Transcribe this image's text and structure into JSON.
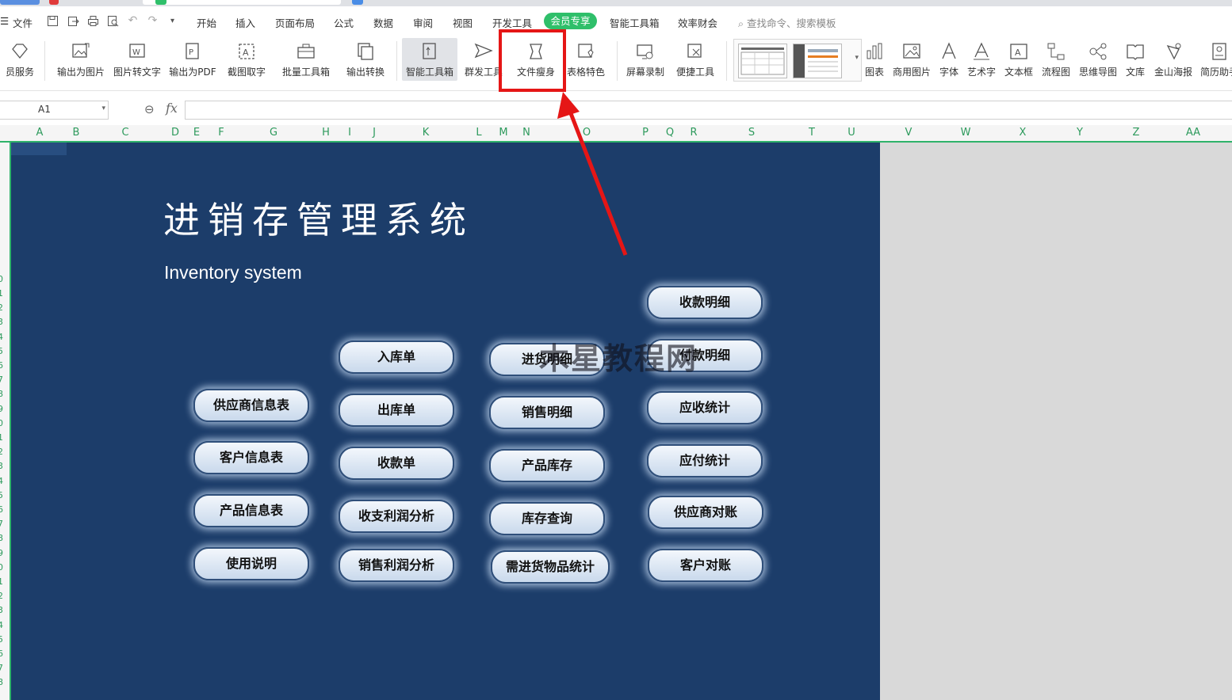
{
  "menubar": {
    "file_menu": "文件",
    "tabs": [
      "开始",
      "插入",
      "页面布局",
      "公式",
      "数据",
      "审阅",
      "视图",
      "开发工具"
    ],
    "member_tab": "会员专享",
    "extra_tabs": [
      "智能工具箱",
      "效率财会"
    ],
    "search_placeholder": "查找命令、搜索模板"
  },
  "ribbon": {
    "buttons": [
      {
        "label": "员服务",
        "icon": "diamond-icon"
      },
      {
        "label": "输出为图片",
        "icon": "export-image-icon"
      },
      {
        "label": "图片转文字",
        "icon": "image-to-text-icon"
      },
      {
        "label": "输出为PDF",
        "icon": "export-pdf-icon"
      },
      {
        "label": "截图取字",
        "icon": "screenshot-ocr-icon"
      },
      {
        "label": "批量工具箱",
        "icon": "toolbox-icon"
      },
      {
        "label": "输出转换",
        "icon": "convert-icon"
      },
      {
        "label": "智能工具箱",
        "icon": "smart-toolbox-icon"
      },
      {
        "label": "群发工具",
        "icon": "send-icon"
      },
      {
        "label": "文件瘦身",
        "icon": "file-slim-icon"
      },
      {
        "label": "表格特色",
        "icon": "table-feature-icon"
      },
      {
        "label": "屏幕录制",
        "icon": "screen-record-icon"
      },
      {
        "label": "便捷工具",
        "icon": "handy-tools-icon"
      },
      {
        "label": "图表",
        "icon": "chart-icon"
      },
      {
        "label": "商用图片",
        "icon": "picture-icon"
      },
      {
        "label": "字体",
        "icon": "font-icon"
      },
      {
        "label": "艺术字",
        "icon": "wordart-icon"
      },
      {
        "label": "文本框",
        "icon": "textbox-icon"
      },
      {
        "label": "流程图",
        "icon": "flowchart-icon"
      },
      {
        "label": "思维导图",
        "icon": "mindmap-icon"
      },
      {
        "label": "文库",
        "icon": "library-icon"
      },
      {
        "label": "金山海报",
        "icon": "poster-icon"
      },
      {
        "label": "简历助手",
        "icon": "resume-icon"
      }
    ]
  },
  "formula_bar": {
    "cell_ref": "A1",
    "fx": "fx",
    "formula": ""
  },
  "columns": [
    "A",
    "B",
    "C",
    "D",
    "E",
    "F",
    "G",
    "H",
    "I",
    "J",
    "K",
    "L",
    "M",
    "N",
    "O",
    "P",
    "Q",
    "R",
    "S",
    "T",
    "U",
    "V",
    "W",
    "X",
    "Y",
    "Z",
    "AA"
  ],
  "rows": [
    "",
    "",
    "",
    "",
    "",
    "",
    "",
    "",
    "",
    "0",
    "1",
    "2",
    "3",
    "4",
    "5",
    "6",
    "7",
    "8",
    "9",
    "0",
    "1",
    "2",
    "3",
    "4",
    "5",
    "6",
    "7",
    "8",
    "9",
    "0",
    "1",
    "2",
    "3",
    "4",
    "5",
    "6",
    "7",
    "8"
  ],
  "sheet": {
    "title": "进销存管理系统",
    "subtitle": "Inventory system",
    "buttons": [
      "供应商信息表",
      "客户信息表",
      "产品信息表",
      "使用说明",
      "入库单",
      "出库单",
      "收款单",
      "收支利润分析",
      "销售利润分析",
      "进货明细",
      "销售明细",
      "产品库存",
      "库存查询",
      "需进货物品统计",
      "收款明细",
      "付款明细",
      "应收统计",
      "应付统计",
      "供应商对账",
      "客户对账"
    ]
  },
  "watermark": "木星教程网",
  "colors": {
    "panel_bg": "#1c3d6a",
    "accent_green": "#2fb36a",
    "annotation_red": "#e51616"
  }
}
